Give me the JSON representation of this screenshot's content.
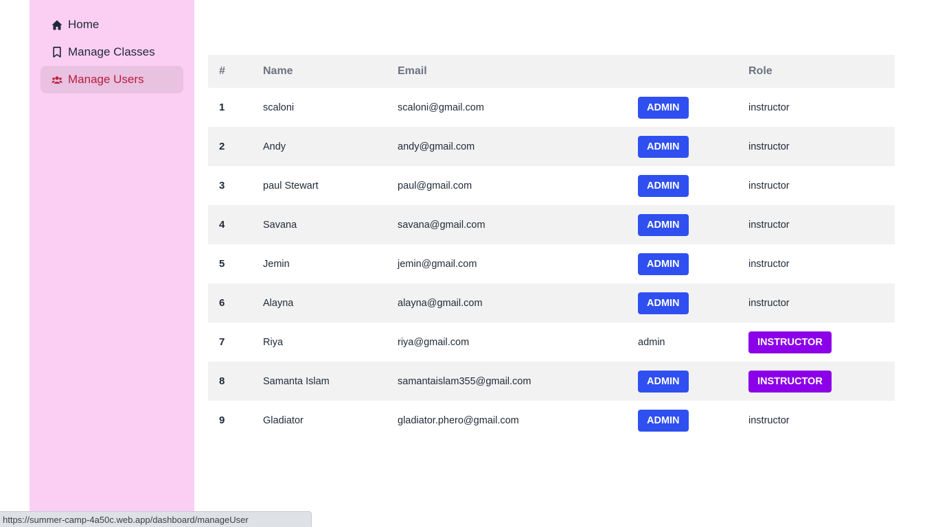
{
  "sidebar": {
    "items": [
      {
        "label": "Home",
        "icon": "home-icon",
        "active": false
      },
      {
        "label": "Manage Classes",
        "icon": "bookmark-icon",
        "active": false
      },
      {
        "label": "Manage Users",
        "icon": "users-icon",
        "active": true
      }
    ]
  },
  "table": {
    "headers": {
      "num": "#",
      "name": "Name",
      "email": "Email",
      "action": "",
      "role": "Role"
    },
    "rows": [
      {
        "num": "1",
        "name": "scaloni",
        "email": "scaloni@gmail.com",
        "admin": "ADMIN",
        "role": "instructor"
      },
      {
        "num": "2",
        "name": "Andy",
        "email": "andy@gmail.com",
        "admin": "ADMIN",
        "role": "instructor"
      },
      {
        "num": "3",
        "name": "paul Stewart",
        "email": "paul@gmail.com",
        "admin": "ADMIN",
        "role": "instructor"
      },
      {
        "num": "4",
        "name": "Savana",
        "email": "savana@gmail.com",
        "admin": "ADMIN",
        "role": "instructor"
      },
      {
        "num": "5",
        "name": "Jemin",
        "email": "jemin@gmail.com",
        "admin": "ADMIN",
        "role": "instructor"
      },
      {
        "num": "6",
        "name": "Alayna",
        "email": "alayna@gmail.com",
        "admin": "ADMIN",
        "role": "instructor"
      },
      {
        "num": "7",
        "name": "Riya",
        "email": "riya@gmail.com",
        "admin_text": "admin",
        "role_button": "INSTRUCTOR"
      },
      {
        "num": "8",
        "name": "Samanta Islam",
        "email": "samantaislam355@gmail.com",
        "admin": "ADMIN",
        "role_button": "INSTRUCTOR"
      },
      {
        "num": "9",
        "name": "Gladiator",
        "email": "gladiator.phero@gmail.com",
        "admin": "ADMIN",
        "role": "instructor"
      }
    ]
  },
  "status_bar": {
    "url": "https://summer-camp-4a50c.web.app/dashboard/manageUser"
  },
  "colors": {
    "sidebar_bg": "#fbcff3",
    "active_bg": "#e9c1e1",
    "active_text": "#b91c3c",
    "admin_button": "#2f4ff0",
    "instructor_button": "#8b00e8"
  }
}
